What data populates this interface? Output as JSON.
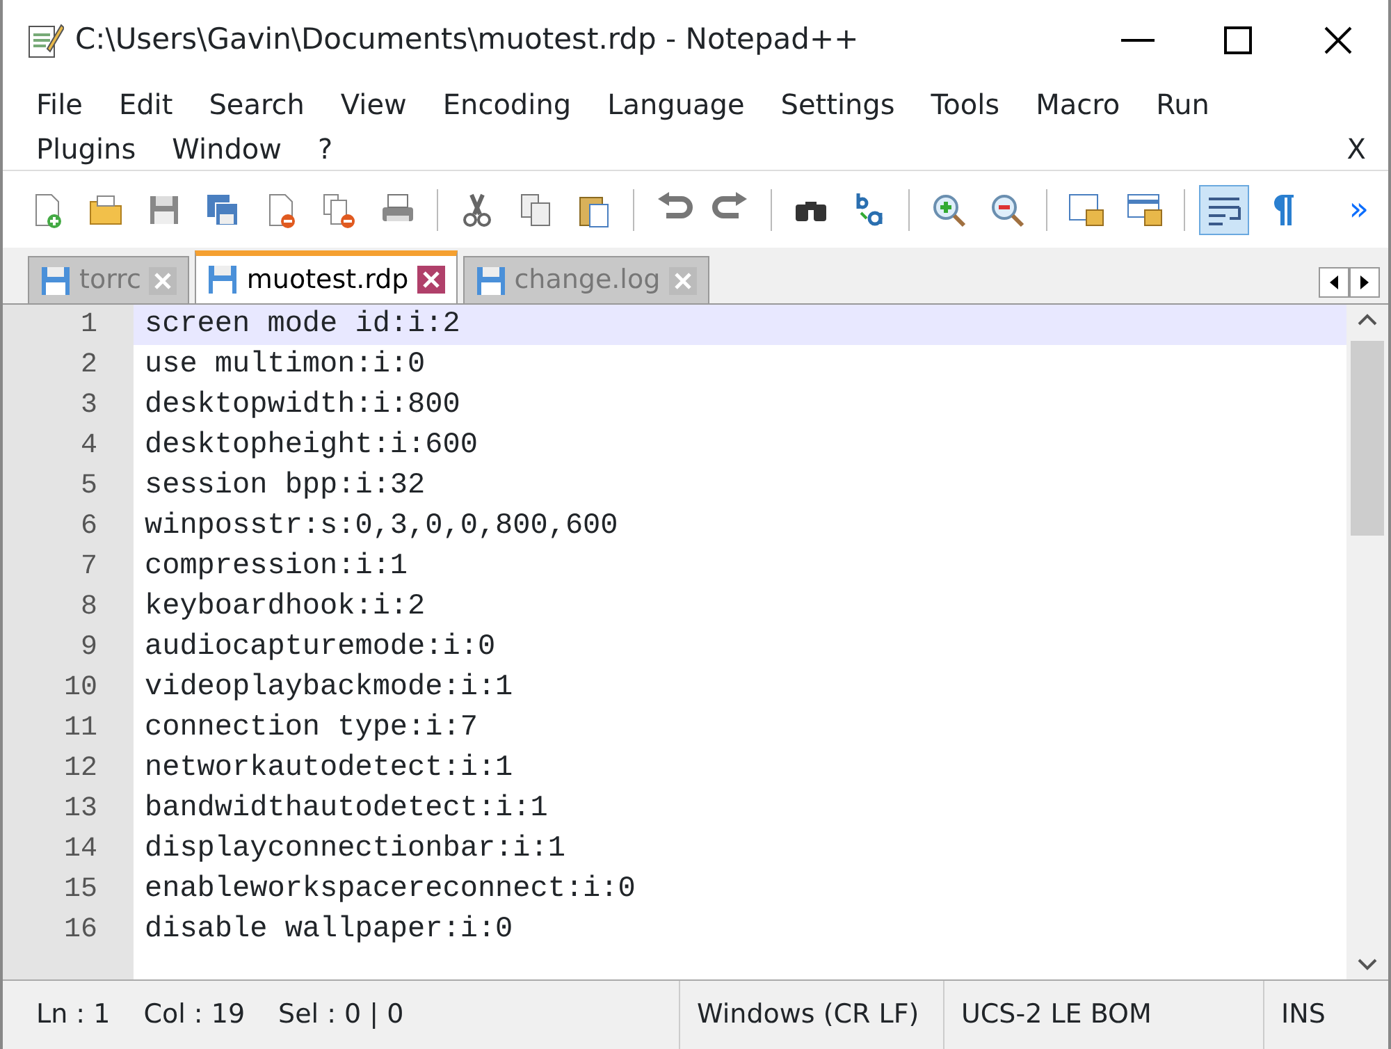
{
  "window": {
    "title": "C:\\Users\\Gavin\\Documents\\muotest.rdp - Notepad++"
  },
  "menu": [
    "File",
    "Edit",
    "Search",
    "View",
    "Encoding",
    "Language",
    "Settings",
    "Tools",
    "Macro",
    "Run",
    "Plugins",
    "Window",
    "?"
  ],
  "menu_close": "X",
  "toolbar": [
    {
      "buttons": [
        {
          "kind": "new",
          "pressed": false
        },
        {
          "kind": "open",
          "pressed": false
        },
        {
          "kind": "save",
          "pressed": false
        },
        {
          "kind": "save-all",
          "pressed": false
        },
        {
          "kind": "close",
          "pressed": false
        },
        {
          "kind": "close-all",
          "pressed": false
        },
        {
          "kind": "print",
          "pressed": false
        }
      ]
    },
    {
      "buttons": [
        {
          "kind": "cut",
          "pressed": false
        },
        {
          "kind": "copy",
          "pressed": false
        },
        {
          "kind": "paste",
          "pressed": false
        }
      ]
    },
    {
      "buttons": [
        {
          "kind": "undo",
          "pressed": false
        },
        {
          "kind": "redo",
          "pressed": false
        }
      ]
    },
    {
      "buttons": [
        {
          "kind": "find",
          "pressed": false
        },
        {
          "kind": "replace",
          "pressed": false
        }
      ]
    },
    {
      "buttons": [
        {
          "kind": "zoom-in",
          "pressed": false
        },
        {
          "kind": "zoom-out",
          "pressed": false
        }
      ]
    },
    {
      "buttons": [
        {
          "kind": "sync-v",
          "pressed": false
        },
        {
          "kind": "sync-h",
          "pressed": false
        }
      ]
    },
    {
      "buttons": [
        {
          "kind": "wrap",
          "pressed": true
        },
        {
          "kind": "all-chars",
          "pressed": false
        }
      ]
    }
  ],
  "toolbar_more": "»",
  "tabs": [
    {
      "label": "torrc",
      "selected": false
    },
    {
      "label": "muotest.rdp",
      "selected": true
    },
    {
      "label": "change.log",
      "selected": false
    }
  ],
  "lines": [
    {
      "number": "1",
      "text": "screen mode id:i:2",
      "current": true
    },
    {
      "number": "2",
      "text": "use multimon:i:0",
      "current": false
    },
    {
      "number": "3",
      "text": "desktopwidth:i:800",
      "current": false
    },
    {
      "number": "4",
      "text": "desktopheight:i:600",
      "current": false
    },
    {
      "number": "5",
      "text": "session bpp:i:32",
      "current": false
    },
    {
      "number": "6",
      "text": "winposstr:s:0,3,0,0,800,600",
      "current": false
    },
    {
      "number": "7",
      "text": "compression:i:1",
      "current": false
    },
    {
      "number": "8",
      "text": "keyboardhook:i:2",
      "current": false
    },
    {
      "number": "9",
      "text": "audiocapturemode:i:0",
      "current": false
    },
    {
      "number": "10",
      "text": "videoplaybackmode:i:1",
      "current": false
    },
    {
      "number": "11",
      "text": "connection type:i:7",
      "current": false
    },
    {
      "number": "12",
      "text": "networkautodetect:i:1",
      "current": false
    },
    {
      "number": "13",
      "text": "bandwidthautodetect:i:1",
      "current": false
    },
    {
      "number": "14",
      "text": "displayconnectionbar:i:1",
      "current": false
    },
    {
      "number": "15",
      "text": "enableworkspacereconnect:i:0",
      "current": false
    },
    {
      "number": "16",
      "text": "disable wallpaper:i:0",
      "current": false
    }
  ],
  "status_bar": {
    "left": [
      "Ln : 1",
      "Col : 19",
      "Sel : 0 | 0"
    ],
    "eol": "Windows (CR LF)",
    "encoding": "UCS-2 LE BOM",
    "mode": "INS"
  }
}
